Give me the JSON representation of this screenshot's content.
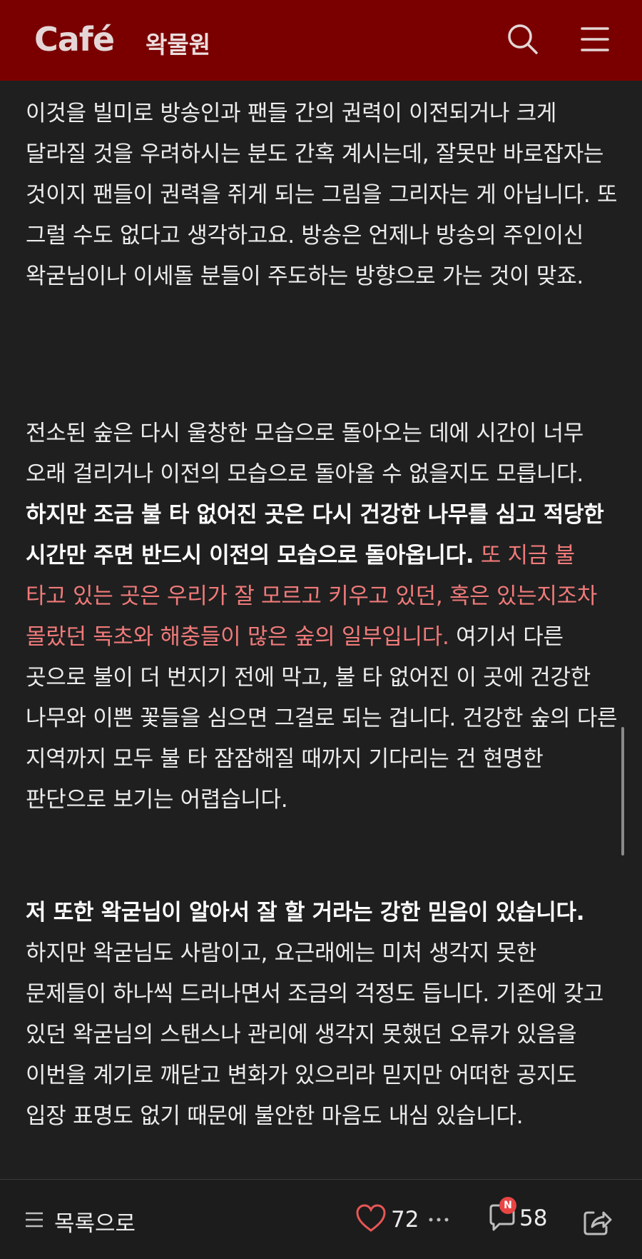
{
  "header": {
    "logo": "Café",
    "cafe_name": "왁물원",
    "search_icon": "search-icon",
    "menu_icon": "menu-icon"
  },
  "article": {
    "p1": "이것을 빌미로 방송인과 팬들 간의 권력이 이전되거나 크게 달라질 것을 우려하시는 분도 간혹 계시는데, 잘못만 바로잡자는 것이지 팬들이 권력을 쥐게 되는 그림을 그리자는 게 아닙니다. 또 그럴 수도 없다고 생각하고요. 방송은 언제나 방송의 주인이신 왁굳님이나 이세돌 분들이 주도하는 방향으로 가는 것이 맞죠.",
    "p2_a": "전소된 숲은 다시 울창한 모습으로 돌아오는 데에 시간이 너무 오래 걸리거나 이전의 모습으로 돌아올 수 없을지도 모릅니다. ",
    "p2_bold": "하지만 조금 불 타 없어진 곳은 다시 건강한 나무를 심고 적당한 시간만 주면 반드시 이전의 모습으로 돌아옵니다.",
    "p2_red": " 또 지금 불 타고 있는 곳은 우리가 잘 모르고 키우고 있던, 혹은 있는지조차 몰랐던 독초와 해충들이 많은 숲의 일부입니다.",
    "p2_b": " 여기서 다른 곳으로 불이 더 번지기 전에 막고, 불 타 없어진 이 곳에 건강한 나무와 이쁜 꽃들을 심으면 그걸로 되는 겁니다. 건강한 숲의 다른 지역까지 모두 불 타 잠잠해질 때까지 기다리는 건 현명한 판단으로 보기는 어렵습니다.",
    "p3_bold": "저 또한 왁굳님이 알아서 잘 할 거라는 강한 믿음이 있습니다.",
    "p3_a": " 하지만 왁굳님도 사람이고, 요근래에는 미처 생각지 못한 문제들이 하나씩 드러나면서 조금의 걱정도 듭니다. 기존에 갖고 있던 왁굳님의 스탠스나 관리에 생각지 못했던 오류가 있음을 이번을 계기로 깨닫고 변화가 있으리라 믿지만 어떠한 공지도 입장 표명도 없기 때문에 불안한 마음도 내심 있습니다."
  },
  "bottom_bar": {
    "list_label": "목록으로",
    "like_count": "72",
    "comment_count": "58",
    "new_badge": "N"
  },
  "colors": {
    "header_bg": "#7a0000",
    "page_bg": "#1f1f1f",
    "highlight_red": "#f07a7a"
  }
}
